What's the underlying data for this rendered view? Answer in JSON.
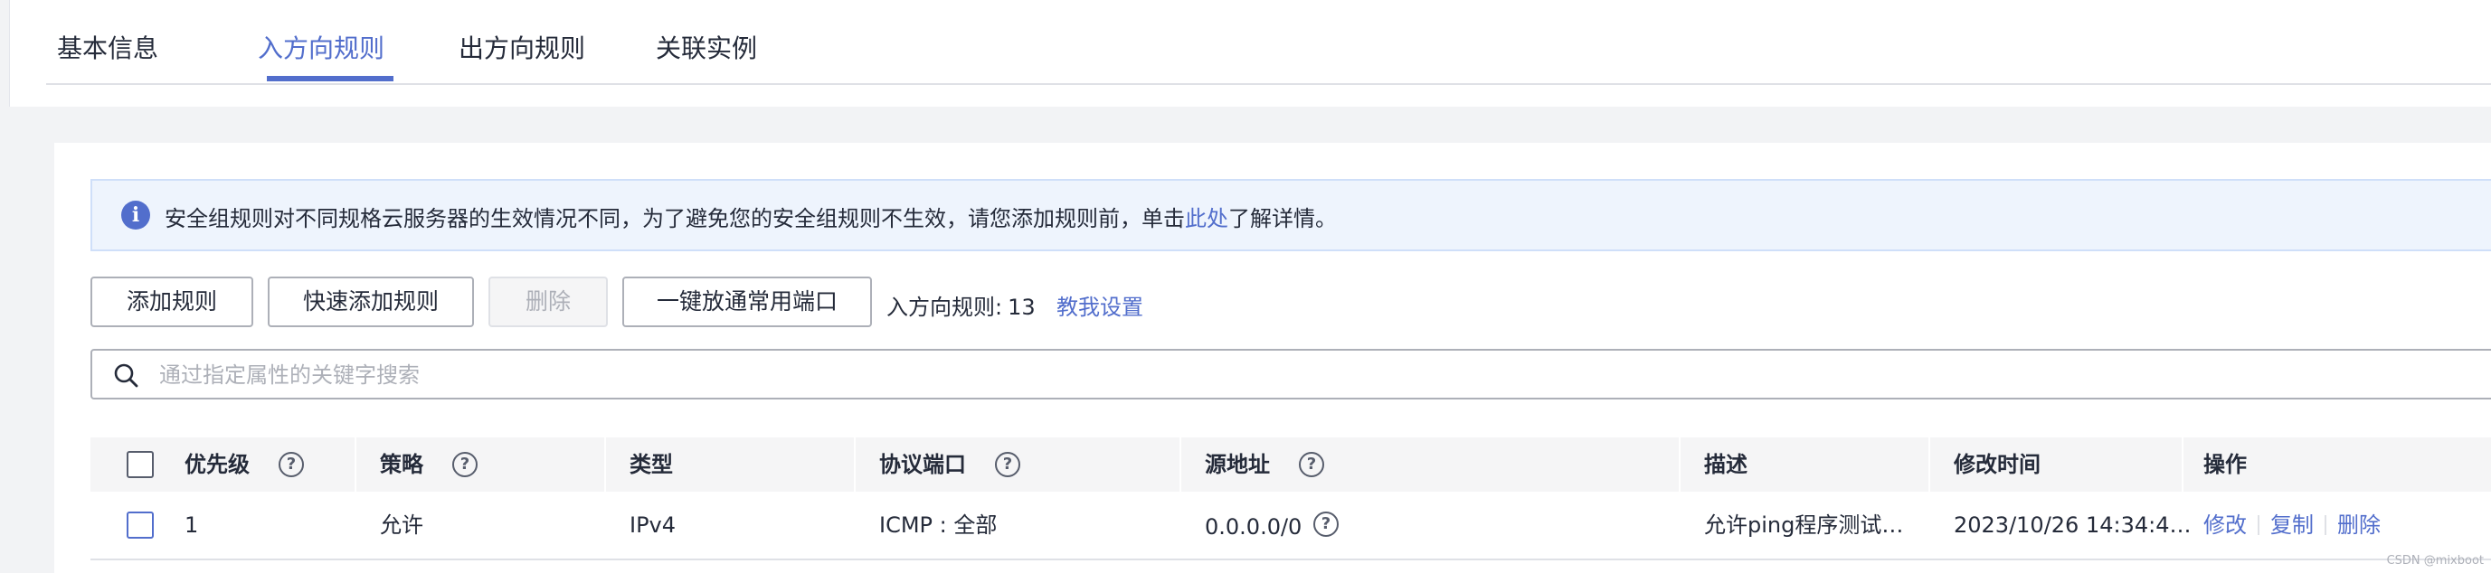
{
  "tabs": [
    {
      "label": "基本信息",
      "active": false
    },
    {
      "label": "入方向规则",
      "active": true
    },
    {
      "label": "出方向规则",
      "active": false
    },
    {
      "label": "关联实例",
      "active": false
    }
  ],
  "notice": {
    "icon": "info-icon",
    "text_before": "安全组规则对不同规格云服务器的生效情况不同，为了避免您的安全组规则不生效，请您添加规则前，单击",
    "link": "此处",
    "text_after": "了解详情。"
  },
  "toolbar": {
    "add_rule": "添加规则",
    "quick_add_rule": "快速添加规则",
    "delete": "删除",
    "open_common_ports": "一键放通常用端口",
    "rule_count_label": "入方向规则:",
    "rule_count": "13",
    "help_link": "教我设置"
  },
  "search": {
    "placeholder": "通过指定属性的关键字搜索",
    "value": ""
  },
  "table": {
    "columns": {
      "priority": "优先级",
      "policy": "策略",
      "type": "类型",
      "protocol_port": "协议端口",
      "source": "源地址",
      "description": "描述",
      "modified_time": "修改时间",
      "actions": "操作"
    },
    "rows": [
      {
        "priority": "1",
        "policy": "允许",
        "type": "IPv4",
        "protocol_port": "ICMP : 全部",
        "source": "0.0.0.0/0",
        "description": "允许ping程序测试…",
        "modified_time": "2023/10/26 14:34:4…",
        "actions": [
          "修改",
          "复制",
          "删除"
        ]
      }
    ]
  },
  "watermark": "CSDN @mixboot",
  "colors": {
    "accent": "#526ecc",
    "notice_bg": "#eef4fd",
    "header_bg": "#f5f5f6"
  }
}
